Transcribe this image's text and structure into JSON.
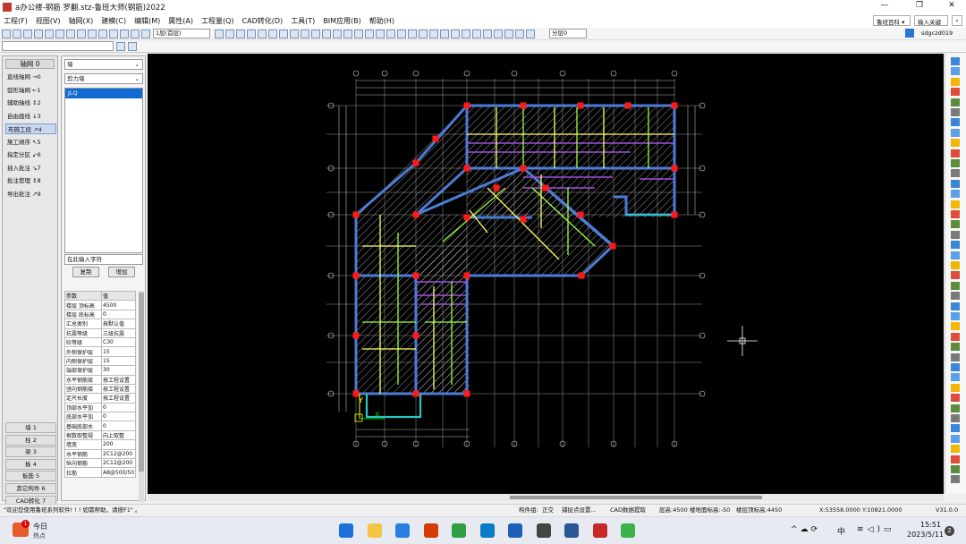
{
  "window": {
    "title": "a办公楼-钢筋 罗翻.stz-鲁班大师(钢筋)2022",
    "minimize": "—",
    "restore": "❐",
    "close": "✕"
  },
  "menu": {
    "items": [
      "工程(F)",
      "视图(V)",
      "轴网(X)",
      "建模(C)",
      "编辑(M)",
      "属性(A)",
      "工程量(Q)",
      "CAD转化(D)",
      "工具(T)",
      "BIM应用(B)",
      "帮助(H)"
    ],
    "search_scope": "鲁班百科 ▾",
    "search_placeholder": "输入关键字"
  },
  "toolbar": {
    "floor_select": "1层(首层)",
    "layer_select": "分层0",
    "user": "sdgczd019"
  },
  "left_nav": {
    "header": "轴网 0",
    "items": [
      "直线轴网 →0",
      "弧形轴网 ←1",
      "辅助轴线 ↕2",
      "自由画线 ↓3",
      "布施工段 ↗4",
      "施工顺序 ↖5",
      "指定分区 ↙6",
      "插入批注 ↘7",
      "批注管理 ↕8",
      "导出批注 ↗9"
    ],
    "categories": [
      "墙 1",
      "柱 2",
      "梁 3",
      "板 4",
      "板筋 5",
      "其它构件 6",
      "CAD转化 7"
    ]
  },
  "mid_panel": {
    "type_select": "墙",
    "subtype_select": "剪力墙",
    "selected_item": "JLQ",
    "input_placeholder": "在此输入字符",
    "copy_button": "复制",
    "add_button": "增加",
    "properties": {
      "headers": [
        "参数",
        "值"
      ],
      "rows": [
        [
          "楼层 顶标高",
          "4500"
        ],
        [
          "楼层 底标高",
          "0"
        ],
        [
          "汇总类别",
          "按默认值"
        ],
        [
          "抗震等级",
          "三级抗震"
        ],
        [
          "砼等级",
          "C30"
        ],
        [
          "外侧保护层",
          "15"
        ],
        [
          "内侧保护层",
          "15"
        ],
        [
          "端部保护层",
          "30"
        ],
        [
          "水平钢筋接",
          "按工程设置"
        ],
        [
          "竖向钢筋接",
          "按工程设置"
        ],
        [
          "定尺长度",
          "按工程设置"
        ],
        [
          "顶部水平加",
          "0"
        ],
        [
          "底部水平加",
          "0"
        ],
        [
          "基础底部水",
          "0"
        ],
        [
          "根数取整规",
          "向上取整"
        ],
        [
          "墙宽",
          "200"
        ],
        [
          "水平钢筋",
          "2C12@200"
        ],
        [
          "纵向钢筋",
          "2C12@200"
        ],
        [
          "拉筋",
          "A8@500/50"
        ]
      ]
    }
  },
  "canvas": {
    "axis_y_label": "Y",
    "axis_x_label": "X"
  },
  "status": {
    "welcome": "\"欢迎您使用鲁班系列软件! ! !   如需帮助，请按F1\" 。",
    "component_group": "构件组:",
    "ortho": "正交",
    "snap": "捕捉点设置...",
    "cad_extract": "CAD数据提取",
    "floor_height": "层高:4500",
    "floor_ground": "楼地面标高:-50",
    "floor_top": "楼层顶标高:4450",
    "coords": "X:53558.0000 Y:10821.0000",
    "version": "V31.0.0"
  },
  "taskbar": {
    "weather_title": "今日",
    "weather_sub": "热点",
    "notify_count": "1",
    "ime": "中",
    "time": "15:51",
    "date": "2023/5/11",
    "badge": "2"
  },
  "colors": {
    "wall_blue": "#4d7cd6",
    "column_red": "#ff1a1a",
    "beam_green": "#9cff3c",
    "beam_yellow": "#ffff66",
    "beam_purple": "#a050e0",
    "hatch_white": "#d8d8d8",
    "edge_cyan": "#2ec4c4",
    "selection_blue": "#0f6ad1"
  }
}
